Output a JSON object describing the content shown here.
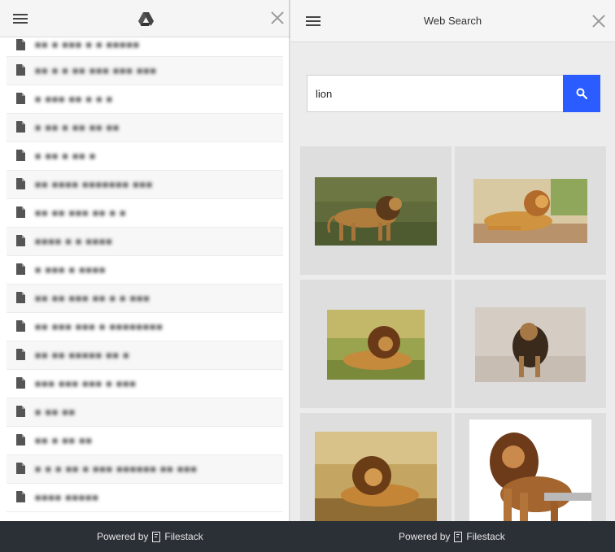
{
  "left_panel": {
    "menu_icon": "hamburger-menu-icon",
    "brand_icon": "google-drive-icon",
    "close_icon": "close-icon",
    "files": [
      {
        "name": "■■ ■ ■■■ ■ ■ ■■■■■",
        "icon": "file-icon"
      },
      {
        "name": "■■ ■ ■ ■■ ■■■ ■■■ ■■■",
        "icon": "file-icon"
      },
      {
        "name": "■ ■■■ ■■ ■ ■ ■",
        "icon": "file-icon"
      },
      {
        "name": "■ ■■ ■ ■■ ■■ ■■",
        "icon": "file-icon"
      },
      {
        "name": "■ ■■ ■ ■■ ■",
        "icon": "file-icon"
      },
      {
        "name": "■■ ■■■■ ■■■■■■■ ■■■",
        "icon": "file-icon"
      },
      {
        "name": "■■ ■■ ■■■ ■■ ■ ■",
        "icon": "file-icon"
      },
      {
        "name": "■■■■ ■ ■ ■■■■",
        "icon": "file-icon"
      },
      {
        "name": "■ ■■■ ■ ■■■■",
        "icon": "file-icon"
      },
      {
        "name": "■■ ■■ ■■■ ■■ ■ ■ ■■■",
        "icon": "file-icon"
      },
      {
        "name": "■■ ■■■ ■■■ ■ ■■■■■■■■",
        "icon": "file-icon"
      },
      {
        "name": "■■ ■■ ■■■■■ ■■ ■",
        "icon": "file-icon"
      },
      {
        "name": "■■■ ■■■ ■■■ ■ ■■■",
        "icon": "file-icon"
      },
      {
        "name": "■ ■■ ■■",
        "icon": "file-icon"
      },
      {
        "name": "■■ ■ ■■ ■■",
        "icon": "file-icon"
      },
      {
        "name": "■ ■ ■ ■■ ■ ■■■ ■■■■■■ ■■ ■■■",
        "icon": "file-icon"
      },
      {
        "name": "■■■■ ■■■■■",
        "icon": "file-icon"
      }
    ],
    "footer": {
      "powered_by": "Powered by",
      "brand": "Filestack"
    }
  },
  "right_panel": {
    "menu_icon": "hamburger-menu-icon",
    "title": "Web Search",
    "close_icon": "close-icon",
    "search": {
      "value": "lion",
      "placeholder": "",
      "button_icon": "search-icon"
    },
    "results": [
      {
        "label": "lion-roaring-image"
      },
      {
        "label": "lion-lying-image"
      },
      {
        "label": "lion-resting-image"
      },
      {
        "label": "lion-walking-image"
      },
      {
        "label": "lion-lying-grass-image"
      },
      {
        "label": "lion-standing-image"
      }
    ],
    "footer": {
      "powered_by": "Powered by",
      "brand": "Filestack"
    }
  },
  "colors": {
    "accent": "#2a5cff",
    "footer_bg": "#2b2f36",
    "header_bg": "#f5f5f5"
  }
}
